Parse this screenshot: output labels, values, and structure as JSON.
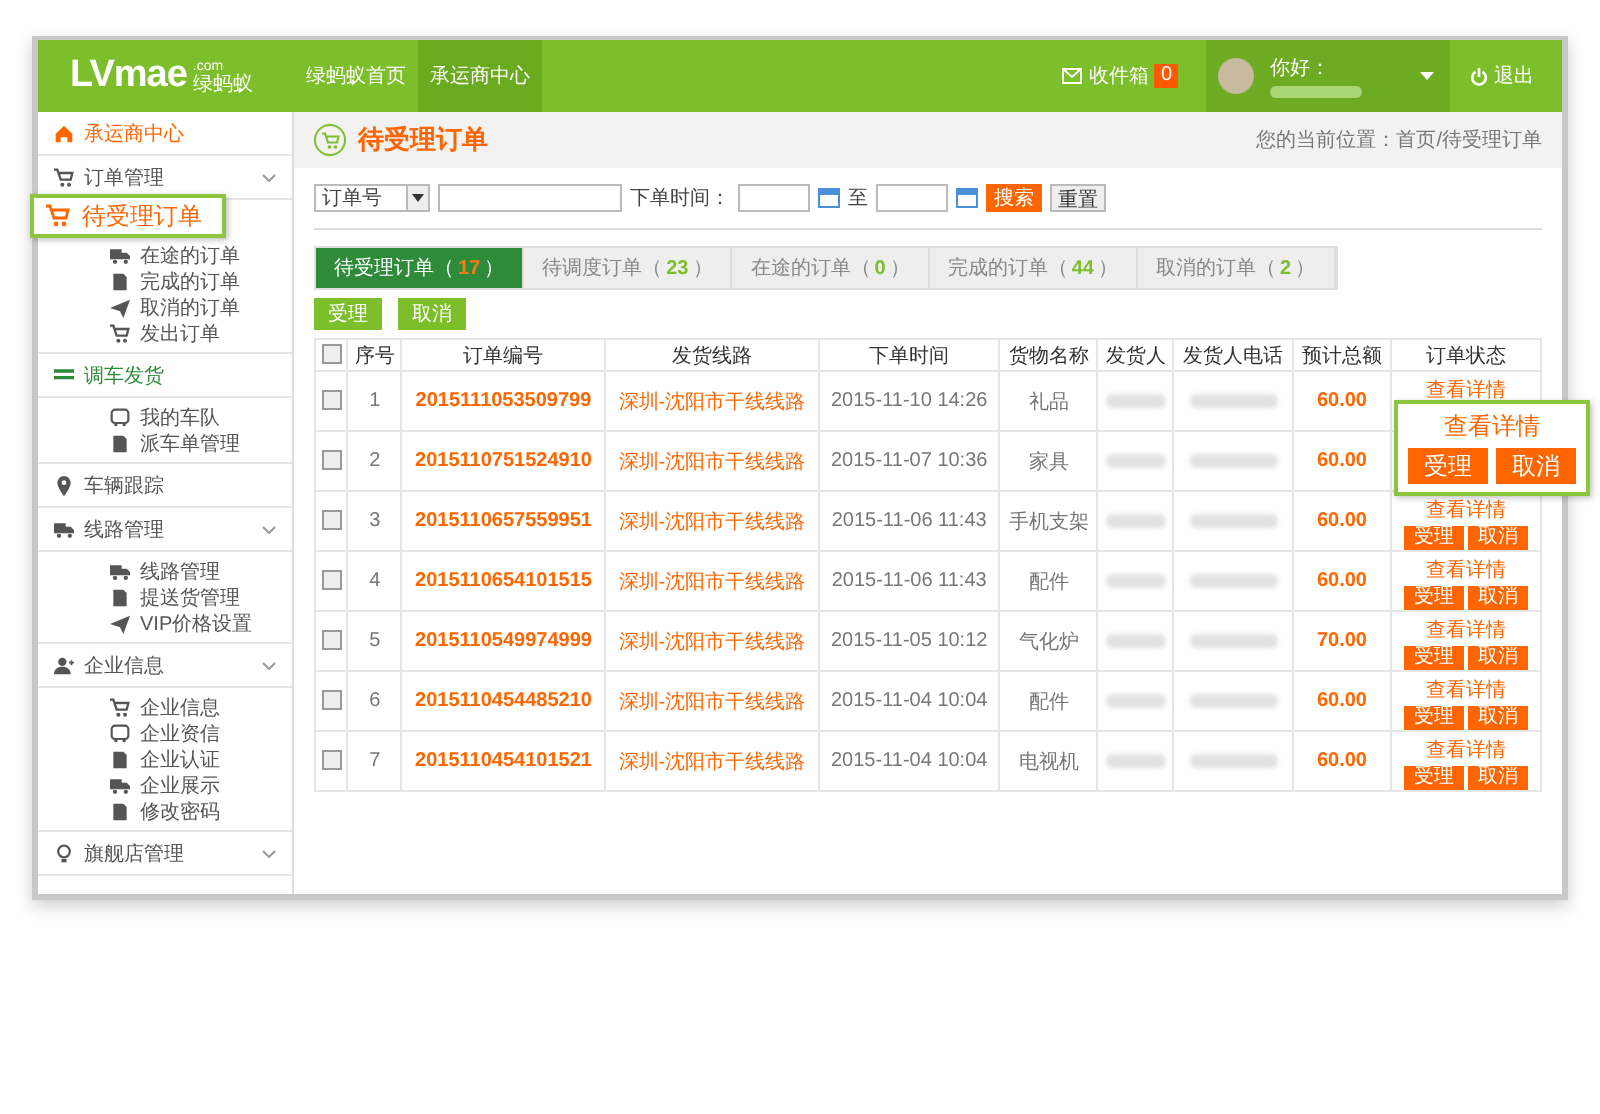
{
  "header": {
    "logo": "LVmae",
    "logo_domain": ".com",
    "logo_subtitle": "绿蚂蚁",
    "nav": [
      {
        "label": "绿蚂蚁首页",
        "selected": false
      },
      {
        "label": "承运商中心",
        "selected": true
      }
    ],
    "inbox": {
      "label": "收件箱",
      "count": "0"
    },
    "greeting": "你好：",
    "logout": "退出"
  },
  "sidebar": {
    "items": [
      {
        "label": "承运商中心",
        "color": "#ff6600",
        "expandable": false
      },
      {
        "label": "订单管理",
        "color": "#555555",
        "expandable": true,
        "children": [
          {
            "label": "在途的订单"
          },
          {
            "label": "完成的订单"
          },
          {
            "label": "取消的订单"
          },
          {
            "label": "发出订单"
          }
        ]
      },
      {
        "label": "调车发货",
        "color": "#2e8b3a",
        "expandable": false,
        "children": [
          {
            "label": "我的车队"
          },
          {
            "label": "派车单管理"
          }
        ]
      },
      {
        "label": "车辆跟踪",
        "color": "#555555",
        "expandable": false
      },
      {
        "label": "线路管理",
        "color": "#555555",
        "expandable": true,
        "children": [
          {
            "label": "线路管理"
          },
          {
            "label": "提送货管理"
          },
          {
            "label": "VIP价格设置"
          }
        ]
      },
      {
        "label": "企业信息",
        "color": "#555555",
        "expandable": true,
        "children": [
          {
            "label": "企业信息"
          },
          {
            "label": "企业资信"
          },
          {
            "label": "企业认证"
          },
          {
            "label": "企业展示"
          },
          {
            "label": "修改密码"
          }
        ]
      },
      {
        "label": "旗舰店管理",
        "color": "#555555",
        "expandable": true
      }
    ],
    "callout": {
      "label": "待受理订单"
    }
  },
  "page": {
    "title": "待受理订单",
    "breadcrumb": "您的当前位置：首页/待受理订单"
  },
  "filter": {
    "field_select": "订单号",
    "time_label": "下单时间：",
    "to_label": "至",
    "search_button": "搜索",
    "reset_button": "重置"
  },
  "tabs": [
    {
      "label": "待受理订单（",
      "count": "17",
      "suffix": "）",
      "selected": true
    },
    {
      "label": "待调度订单（",
      "count": "23",
      "suffix": "）",
      "selected": false
    },
    {
      "label": "在途的订单（",
      "count": "0",
      "suffix": "）",
      "selected": false
    },
    {
      "label": "完成的订单（",
      "count": "44",
      "suffix": "）",
      "selected": false
    },
    {
      "label": "取消的订单（",
      "count": "2",
      "suffix": "）",
      "selected": false
    }
  ],
  "bulk_actions": [
    "受理",
    "取消"
  ],
  "table": {
    "select_all_checked": false,
    "columns": [
      "序号",
      "订单编号",
      "发货线路",
      "下单时间",
      "货物名称",
      "发货人",
      "发货人电话",
      "预计总额",
      "订单状态"
    ],
    "rows": [
      {
        "checked": false,
        "index": "1",
        "order_no": "2015111053509799",
        "route": "深圳-沈阳市干线线路",
        "time": "2015-11-10 14:26",
        "goods": "礼品",
        "amount": "60.00",
        "actions": [
          {
            "kind": "link",
            "label": "查看详情"
          }
        ]
      },
      {
        "checked": false,
        "index": "2",
        "order_no": "2015110751524910",
        "route": "深圳-沈阳市干线线路",
        "time": "2015-11-07 10:36",
        "goods": "家具",
        "amount": "60.00",
        "actions": []
      },
      {
        "checked": false,
        "index": "3",
        "order_no": "2015110657559951",
        "route": "深圳-沈阳市干线线路",
        "time": "2015-11-06 11:43",
        "goods": "手机支架",
        "amount": "60.00",
        "actions": [
          {
            "kind": "link",
            "label": "查看详情"
          },
          {
            "kind": "button",
            "label": "受理"
          },
          {
            "kind": "button",
            "label": "取消"
          }
        ]
      },
      {
        "checked": false,
        "index": "4",
        "order_no": "2015110654101515",
        "route": "深圳-沈阳市干线线路",
        "time": "2015-11-06 11:43",
        "goods": "配件",
        "amount": "60.00",
        "actions": [
          {
            "kind": "link",
            "label": "查看详情"
          },
          {
            "kind": "button",
            "label": "受理"
          },
          {
            "kind": "button",
            "label": "取消"
          }
        ]
      },
      {
        "checked": false,
        "index": "5",
        "order_no": "2015110549974999",
        "route": "深圳-沈阳市干线线路",
        "time": "2015-11-05 10:12",
        "goods": "气化炉",
        "amount": "70.00",
        "actions": [
          {
            "kind": "link",
            "label": "查看详情"
          },
          {
            "kind": "button",
            "label": "受理"
          },
          {
            "kind": "button",
            "label": "取消"
          }
        ]
      },
      {
        "checked": false,
        "index": "6",
        "order_no": "2015110454485210",
        "route": "深圳-沈阳市干线线路",
        "time": "2015-11-04 10:04",
        "goods": "配件",
        "amount": "60.00",
        "actions": [
          {
            "kind": "link",
            "label": "查看详情"
          },
          {
            "kind": "button",
            "label": "受理"
          },
          {
            "kind": "button",
            "label": "取消"
          }
        ]
      },
      {
        "checked": false,
        "index": "7",
        "order_no": "2015110454101521",
        "route": "深圳-沈阳市干线线路",
        "time": "2015-11-04 10:04",
        "goods": "电视机",
        "amount": "60.00",
        "actions": [
          {
            "kind": "link",
            "label": "查看详情"
          },
          {
            "kind": "button",
            "label": "受理"
          },
          {
            "kind": "button",
            "label": "取消"
          }
        ]
      }
    ],
    "callout": {
      "link": "查看详情",
      "buttons": [
        "受理",
        "取消"
      ]
    }
  }
}
